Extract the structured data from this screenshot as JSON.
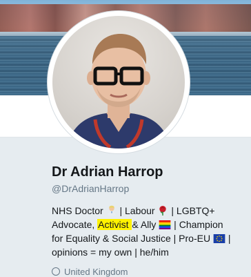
{
  "profile": {
    "name": "Dr Adrian Harrop",
    "handle": "@DrAdrianHarrop",
    "bio": {
      "line1_pre": "NHS Doctor",
      "line1_mid": " | Labour ",
      "line1_post": " | LGBTQ+",
      "line2_pre": "Advocate, ",
      "line2_highlight": "Activist ",
      "line2_post": "& Ally ",
      "line2_tail": " | Champion",
      "line3": "for Equality & Social Justice | Pro-EU ",
      "line3_tail": " |",
      "line4": "opinions = my own | he/him"
    },
    "location_partial": "United Kingdom"
  },
  "colors": {
    "name": "#14171a",
    "secondary": "#657786",
    "highlight": "#fff200",
    "background": "#e6ecf0"
  },
  "icons": [
    "doctor-emoji-icon",
    "rose-emoji-icon",
    "rainbow-flag-icon",
    "eu-flag-icon",
    "location-icon"
  ]
}
